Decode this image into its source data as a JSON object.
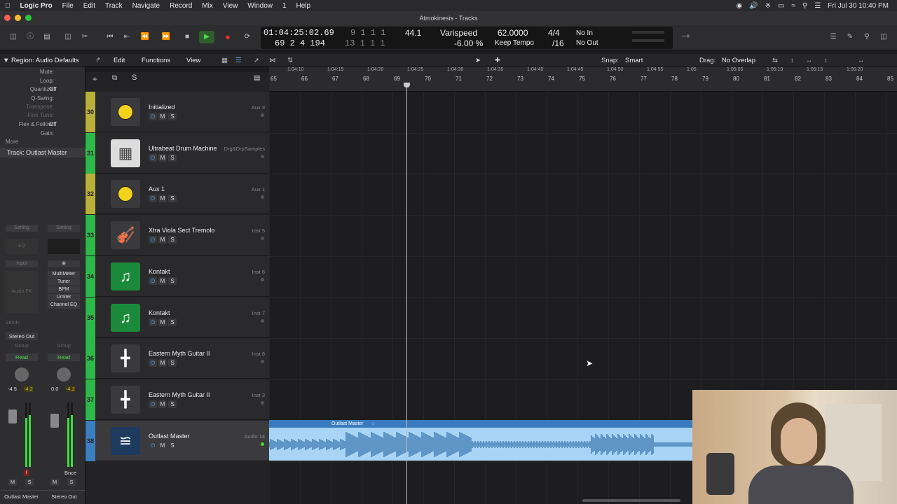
{
  "menubar": {
    "app": "Logic Pro",
    "items": [
      "File",
      "Edit",
      "Track",
      "Navigate",
      "Record",
      "Mix",
      "View",
      "Window",
      "1",
      "Help"
    ],
    "clock": "Fri Jul 30  10:40 PM"
  },
  "window": {
    "title": "Atmokinesis - Tracks"
  },
  "lcd": {
    "time": "01:04:25:02.69",
    "bars": "69  2  4  194",
    "beats_top": "9  1  1  1",
    "beats_bot": "13  1  1  1",
    "rate": "44.1",
    "mode": "Varispeed",
    "varispeed": "-6.00 %",
    "tempo": "62.0000",
    "keep": "Keep Tempo",
    "sig": "4/4",
    "div": "/16",
    "in": "No In",
    "out": "No Out"
  },
  "toolbar2": {
    "edit": "Edit",
    "functions": "Functions",
    "view": "View",
    "snap_label": "Snap:",
    "snap_value": "Smart",
    "drag_label": "Drag:",
    "drag_value": "No Overlap"
  },
  "inspector": {
    "region_title": "Region: Audio Defaults",
    "rows": [
      {
        "label": "Mute:",
        "value": ""
      },
      {
        "label": "Loop:",
        "value": ""
      },
      {
        "label": "Quantize:",
        "value": "Off"
      },
      {
        "label": "Q-Swing:",
        "value": ""
      },
      {
        "label": "Transpose:",
        "value": ""
      },
      {
        "label": "Fine Tune:",
        "value": ""
      },
      {
        "label": "Flex & Follow:",
        "value": "Off"
      },
      {
        "label": "Gain:",
        "value": ""
      }
    ],
    "more": "More",
    "track_title": "Track:  Outlast Master",
    "setting": "Setting",
    "eq": "EQ",
    "input": "Input",
    "audio_fx": "Audio FX",
    "plugins": [
      "MultiMeter",
      "Tuner",
      "BPM",
      "Limiter",
      "Channel EQ"
    ],
    "sends": "Sends",
    "stereo_out": "Stereo Out",
    "group": "Group",
    "read": "Read",
    "vol_l": "-4.5",
    "peak_l": "-4.2",
    "vol_r": "0.0",
    "peak_r": "-4.2",
    "bnce": "Bnce",
    "m": "M",
    "s": "S",
    "strip_l": "Outlast Master",
    "strip_r": "Stereo Out"
  },
  "tracks": [
    {
      "num": "30",
      "name": "Initialized",
      "out": "Aux 3",
      "color": "#b8b03a",
      "icon": "knob"
    },
    {
      "num": "31",
      "name": "Ultrabeat Drum Machine",
      "out": "Drg&DrpSamples",
      "color": "#2fb84a",
      "icon": "drum-machine"
    },
    {
      "num": "32",
      "name": "Aux 1",
      "out": "Aux 1",
      "color": "#b8b03a",
      "icon": "knob"
    },
    {
      "num": "33",
      "name": "Xtra Viola Sect Tremolo",
      "out": "Inst 5",
      "color": "#2fb84a",
      "icon": "strings"
    },
    {
      "num": "34",
      "name": "Kontakt",
      "out": "Inst 6",
      "color": "#2fb84a",
      "icon": "note"
    },
    {
      "num": "35",
      "name": "Kontakt",
      "out": "Inst 7",
      "color": "#2fb84a",
      "icon": "note"
    },
    {
      "num": "36",
      "name": "Eastern Myth Guitar II",
      "out": "Inst 8",
      "color": "#2fb84a",
      "icon": "keyboard-stand"
    },
    {
      "num": "37",
      "name": "Eastern Myth Guitar II",
      "out": "Inst 3",
      "color": "#2fb84a",
      "icon": "keyboard-stand"
    },
    {
      "num": "38",
      "name": "Outlast Master",
      "out": "Audio 14",
      "color": "#3b7fc0",
      "icon": "waveform"
    }
  ],
  "track_buttons": {
    "m": "M",
    "s": "S"
  },
  "ruler": {
    "times": [
      "1:04:10",
      "1:04:15",
      "1:04:20",
      "1:04:25",
      "1:04:30",
      "1:04:35",
      "1:04:40",
      "1:04:45",
      "1:04:50",
      "1:04:55",
      "1:05",
      "1:05:05",
      "1:05:10",
      "1:05:15",
      "1:05:20"
    ],
    "bars": [
      "65",
      "66",
      "67",
      "68",
      "69",
      "70",
      "71",
      "72",
      "73",
      "74",
      "75",
      "76",
      "77",
      "78",
      "79",
      "80",
      "81",
      "82",
      "83",
      "84",
      "85"
    ]
  },
  "region": {
    "name": "Outlast Master"
  }
}
